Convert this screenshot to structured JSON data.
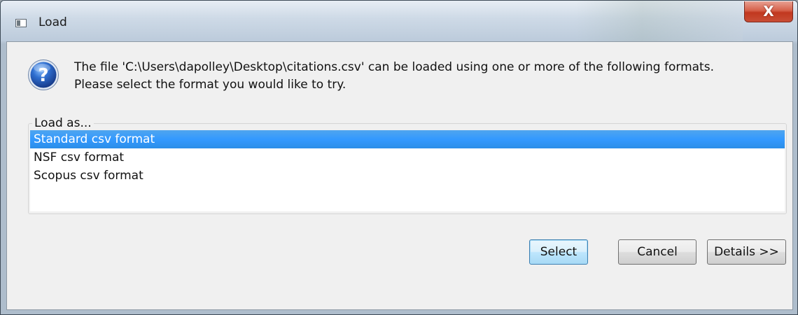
{
  "window": {
    "title": "Load",
    "close_glyph": "X"
  },
  "icons": {
    "app": "application-icon",
    "question": "question-icon",
    "close": "close-icon"
  },
  "message": {
    "line1": "The file 'C:\\Users\\dapolley\\Desktop\\citations.csv' can be loaded using one or more of the following formats.",
    "line2": "Please select the format you would like to try."
  },
  "load_as": {
    "label": "Load as...",
    "options": [
      {
        "label": "Standard csv format",
        "selected": true
      },
      {
        "label": "NSF csv format",
        "selected": false
      },
      {
        "label": "Scopus csv format",
        "selected": false
      }
    ]
  },
  "buttons": {
    "select": "Select",
    "cancel": "Cancel",
    "details": "Details >>"
  },
  "colors": {
    "selection": "#3399ff",
    "close_button": "#c94d35",
    "default_button_border": "#3c7fb1"
  }
}
